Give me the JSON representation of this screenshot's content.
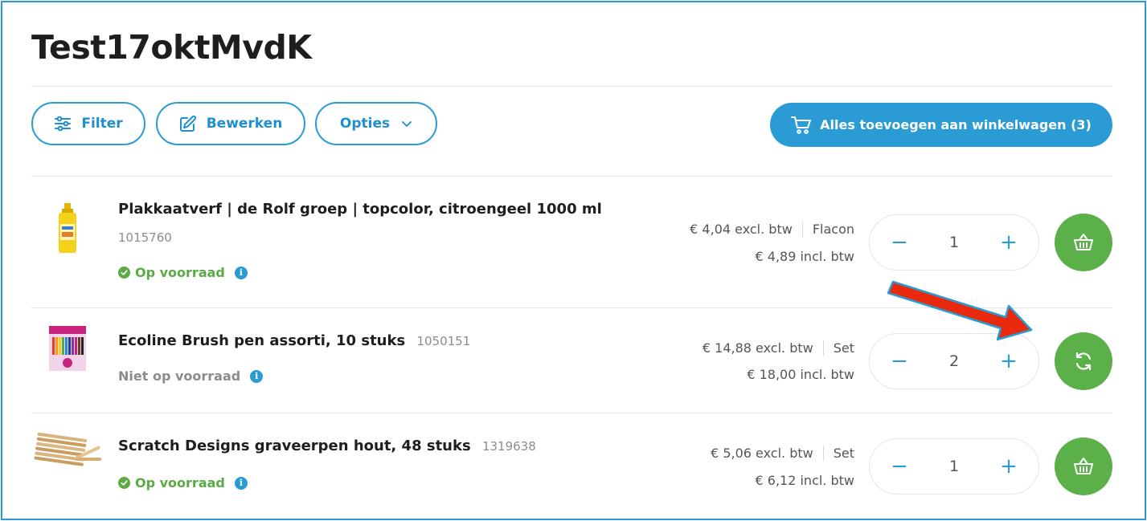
{
  "page": {
    "title": "Test17oktMvdK"
  },
  "toolbar": {
    "filter_label": "Filter",
    "edit_label": "Bewerken",
    "options_label": "Opties",
    "add_all_label": "Alles toevoegen aan winkelwagen (3)"
  },
  "products": [
    {
      "name": "Plakkaatverf | de Rolf groep | topcolor, citroengeel 1000 ml",
      "sku": "1015760",
      "stock": "Op voorraad",
      "price_excl": "€ 4,04 excl. btw",
      "unit": "Flacon",
      "price_incl": "€ 4,89 incl. btw",
      "quantity": "1",
      "action": "basket-icon"
    },
    {
      "name": "Ecoline Brush pen assorti, 10 stuks",
      "sku": "1050151",
      "stock": "Niet op voorraad",
      "price_excl": "€ 14,88 excl. btw",
      "unit": "Set",
      "price_incl": "€ 18,00 incl. btw",
      "quantity": "2",
      "action": "refresh-icon"
    },
    {
      "name": "Scratch Designs graveerpen hout, 48 stuks",
      "sku": "1319638",
      "stock": "Op voorraad",
      "price_excl": "€ 5,06 excl. btw",
      "unit": "Set",
      "price_incl": "€ 6,12 incl. btw",
      "quantity": "1",
      "action": "basket-icon"
    }
  ],
  "qty_controls": {
    "minus": "−",
    "plus": "+"
  },
  "info_glyph": "i",
  "colors": {
    "accent": "#2a9bd4",
    "success": "#5cb04a",
    "muted": "#8c8c8c",
    "arrow": "#e8290b"
  }
}
